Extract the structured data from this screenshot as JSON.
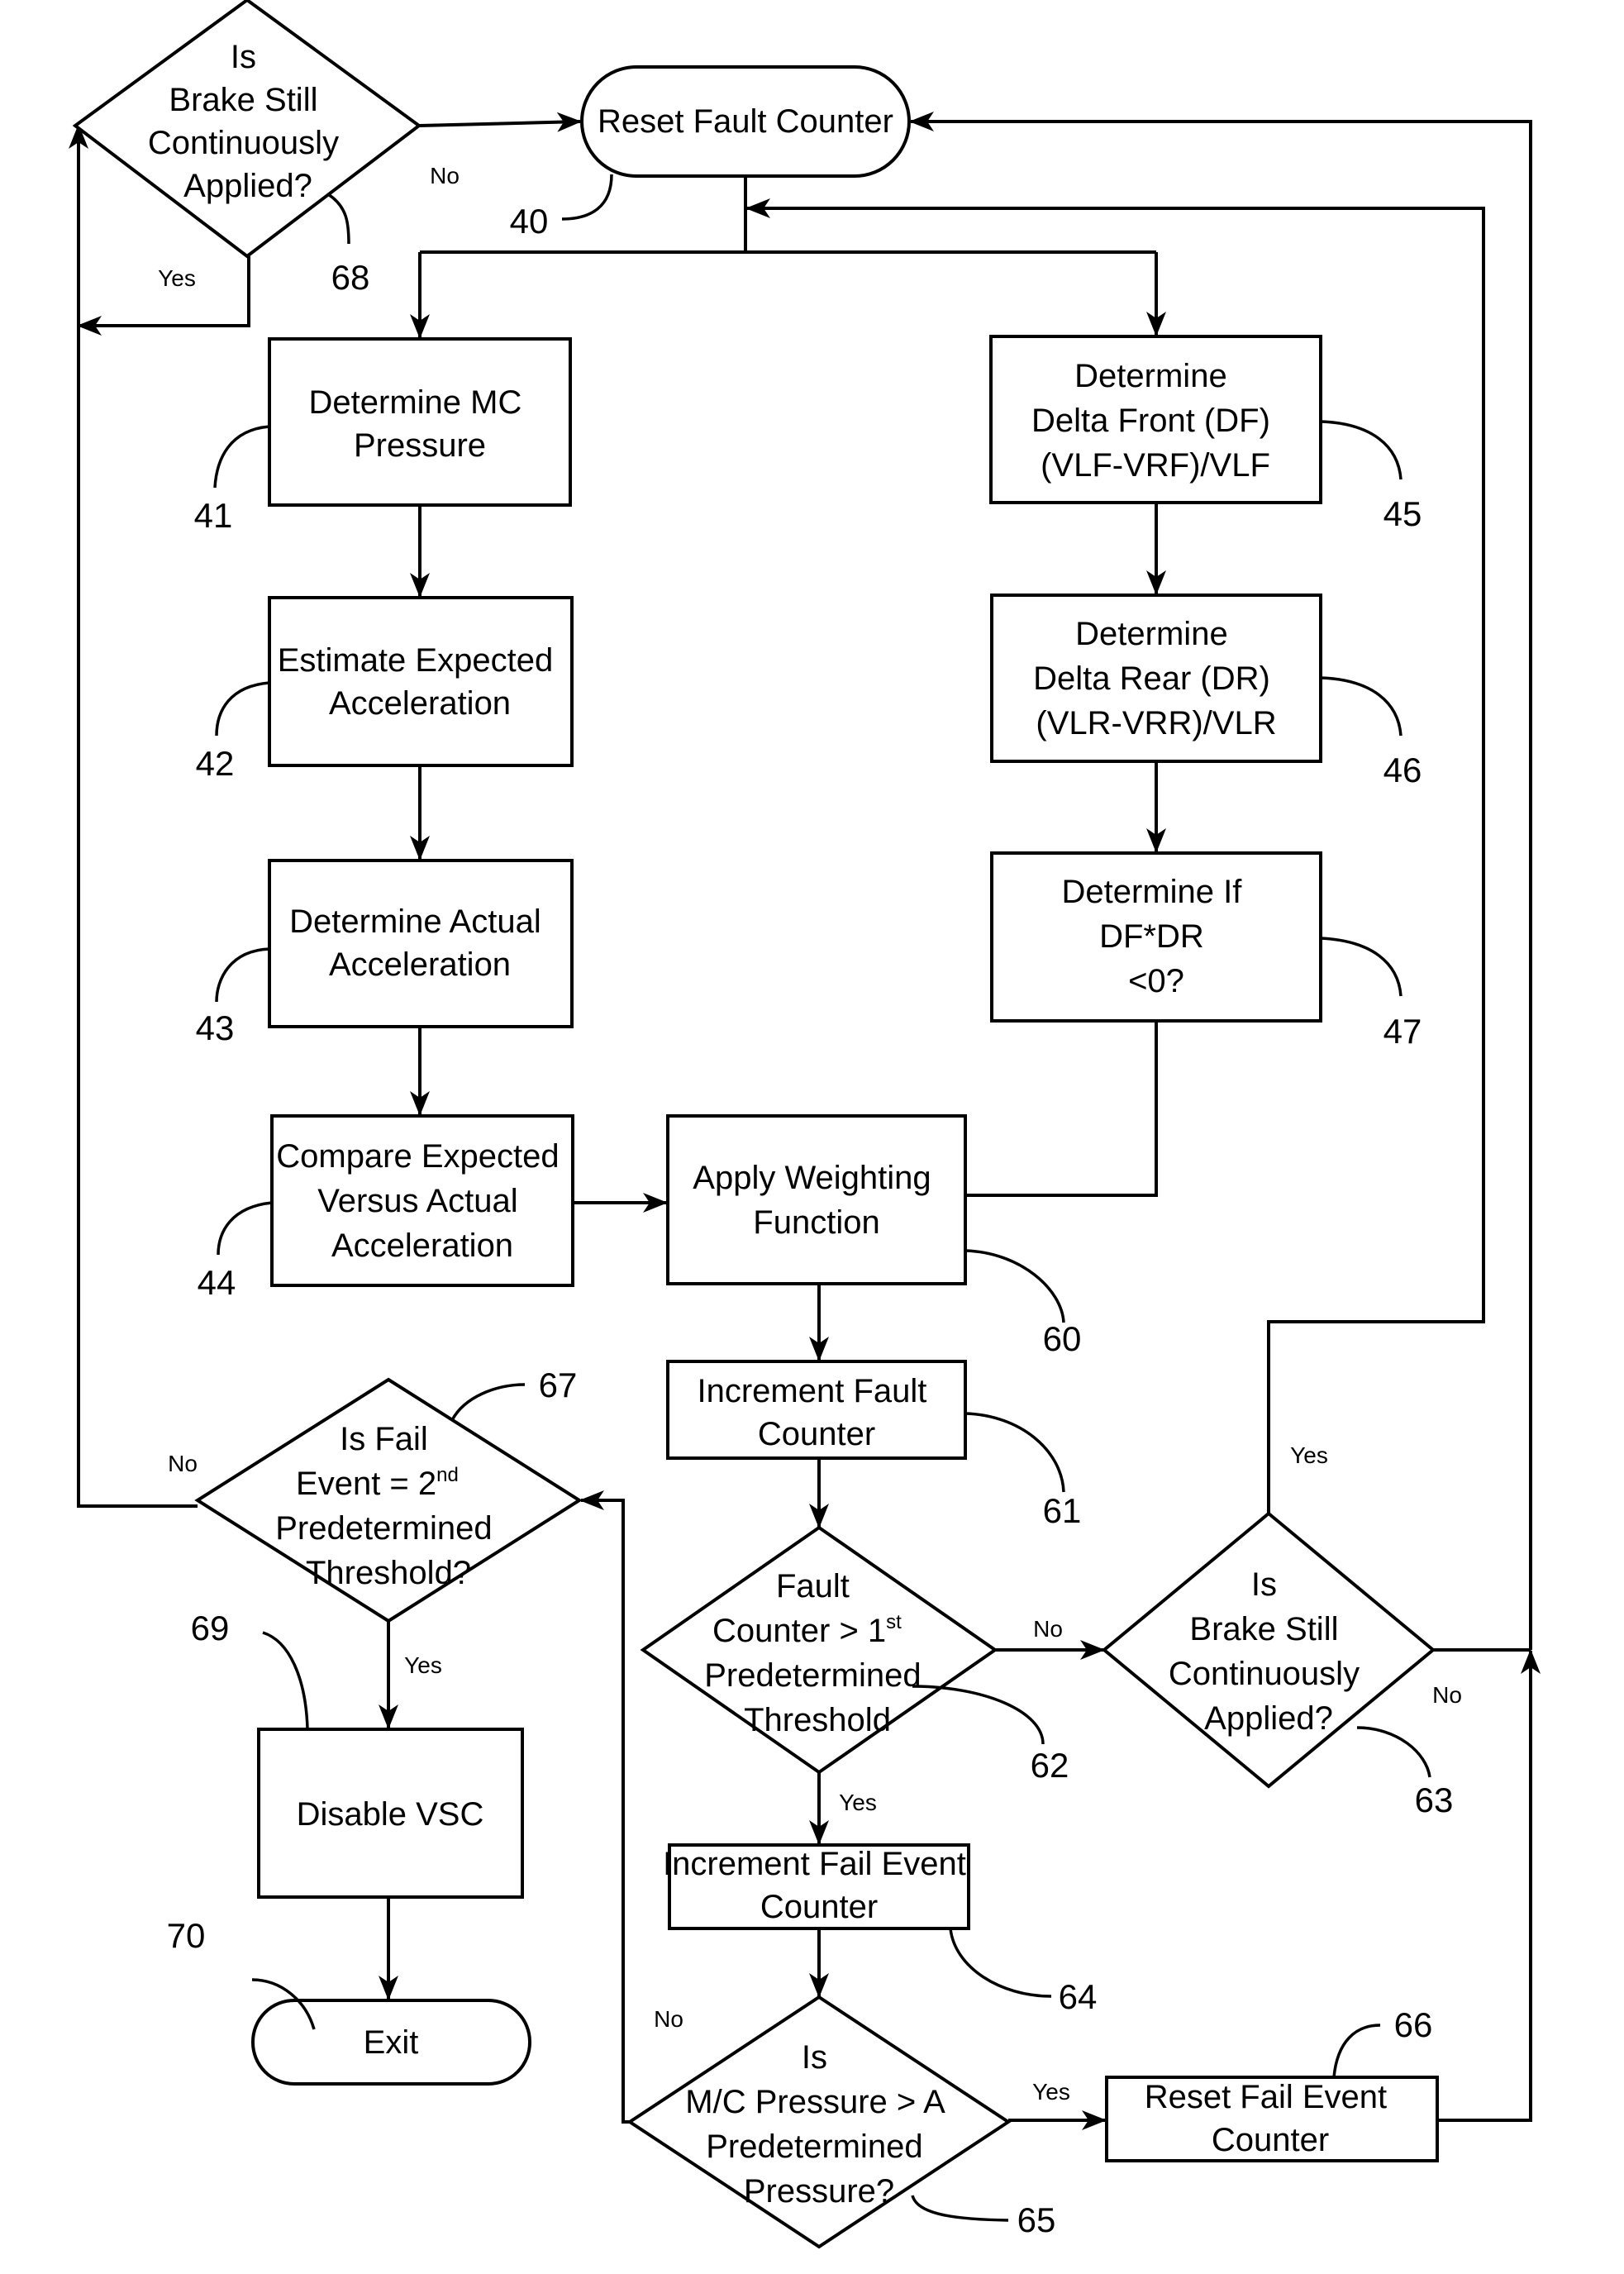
{
  "nodes": {
    "n68": {
      "ref": "68",
      "lines": [
        "Is",
        "Brake  Still",
        "Continuously",
        "Applied?"
      ]
    },
    "n40": {
      "ref": "40",
      "lines": [
        "Reset Fault Counter"
      ]
    },
    "n41": {
      "ref": "41",
      "lines": [
        "Determine MC",
        "Pressure"
      ]
    },
    "n42": {
      "ref": "42",
      "lines": [
        "Estimate Expected",
        "Acceleration"
      ]
    },
    "n43": {
      "ref": "43",
      "lines": [
        "Determine Actual",
        "Acceleration"
      ]
    },
    "n44": {
      "ref": "44",
      "lines": [
        "Compare Expected",
        "Versus Actual",
        "Acceleration"
      ]
    },
    "n45": {
      "ref": "45",
      "lines": [
        "Determine",
        "Delta Front (DF)",
        "(VLF-VRF)/VLF"
      ]
    },
    "n46": {
      "ref": "46",
      "lines": [
        "Determine",
        "Delta Rear (DR)",
        "(VLR-VRR)/VLR"
      ]
    },
    "n47": {
      "ref": "47",
      "lines": [
        "Determine If",
        "DF*DR",
        "<0?"
      ]
    },
    "n60": {
      "ref": "60",
      "lines": [
        "Apply Weighting",
        "Function"
      ]
    },
    "n61": {
      "ref": "61",
      "lines": [
        "Increment Fault",
        "Counter"
      ]
    },
    "n62": {
      "ref": "62",
      "lines": [
        "Fault",
        "Counter > 1",
        "Predetermined",
        "Threshold"
      ],
      "sup": "st"
    },
    "n63": {
      "ref": "63",
      "lines": [
        "Is",
        "Brake  Still",
        "Continuously",
        "Applied?"
      ]
    },
    "n64": {
      "ref": "64",
      "lines": [
        "Increment Fail Event",
        "Counter"
      ]
    },
    "n65": {
      "ref": "65",
      "lines": [
        "Is",
        "M/C Pressure > A",
        "Predetermined",
        "Pressure?"
      ]
    },
    "n66": {
      "ref": "66",
      "lines": [
        "Reset Fail Event",
        "Counter"
      ]
    },
    "n67": {
      "ref": "67",
      "lines": [
        "Is Fail",
        "Event = 2",
        "Predetermined",
        "Threshold?"
      ],
      "sup": "nd"
    },
    "n69": {
      "ref": "69",
      "lines": [
        "Disable VSC"
      ]
    },
    "n70": {
      "ref": "70",
      "lines": [
        "Exit"
      ]
    }
  },
  "edge_labels": {
    "n68_no": "No",
    "n68_yes": "Yes",
    "n62_no": "No",
    "n62_yes": "Yes",
    "n63_no": "No",
    "n63_yes": "Yes",
    "n65_no": "No",
    "n65_yes": "Yes",
    "n67_no": "No",
    "n67_yes": "Yes"
  }
}
